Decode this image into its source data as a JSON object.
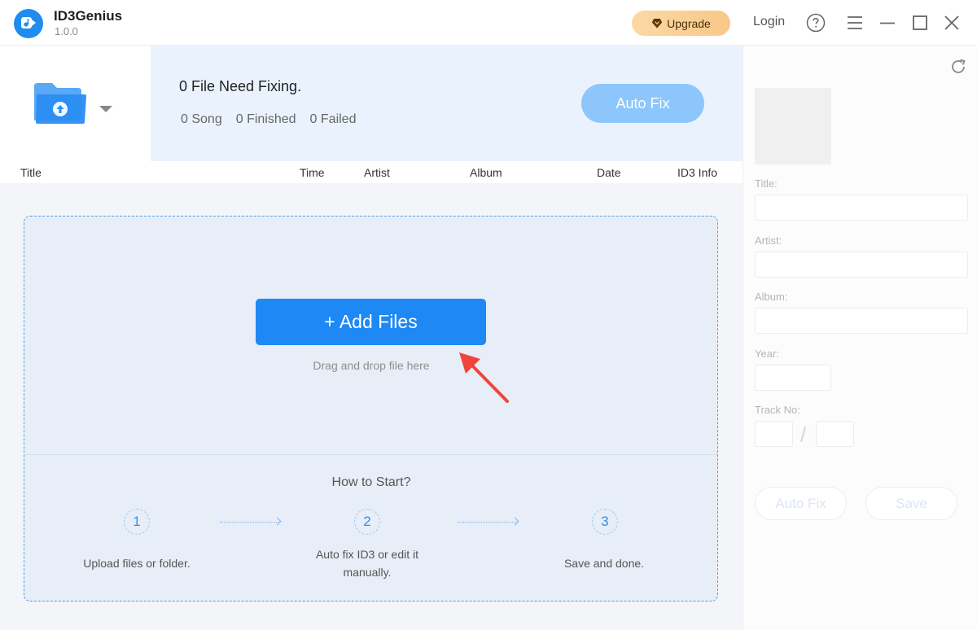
{
  "app": {
    "name": "ID3Genius",
    "version": "1.0.0"
  },
  "titlebar": {
    "upgrade_label": "Upgrade",
    "login_label": "Login"
  },
  "summary": {
    "title": "0 File Need Fixing.",
    "song": "0 Song",
    "finished": "0 Finished",
    "failed": "0 Failed",
    "auto_fix_label": "Auto Fix"
  },
  "table": {
    "columns": [
      "Title",
      "Time",
      "Artist",
      "Album",
      "Date",
      "ID3 Info"
    ]
  },
  "dropzone": {
    "add_files_label": "+ Add Files",
    "hint": "Drag and drop file here",
    "howto_title": "How to Start?",
    "steps": [
      {
        "num": "1",
        "text": "Upload files or folder."
      },
      {
        "num": "2",
        "text": "Auto fix ID3 or edit it manually."
      },
      {
        "num": "3",
        "text": "Save and done."
      }
    ]
  },
  "editor": {
    "title_label": "Title:",
    "artist_label": "Artist:",
    "album_label": "Album:",
    "year_label": "Year:",
    "track_label": "Track No:",
    "track_separator": "/",
    "auto_fix_label": "Auto Fix",
    "save_label": "Save"
  },
  "colors": {
    "accent": "#1e88f4",
    "panel_bg": "#eaf3fd",
    "dropzone_border": "#4aa0ef",
    "upgrade_bg": "#f8c887",
    "arrow": "#f0453c"
  }
}
